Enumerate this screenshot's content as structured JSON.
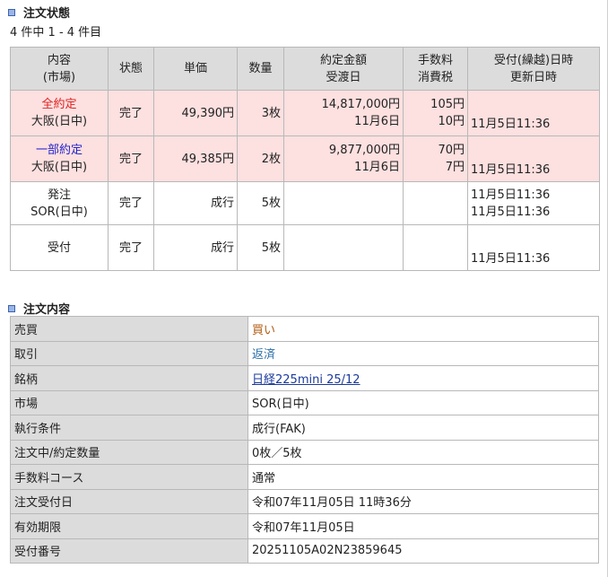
{
  "status_section": {
    "title": "注文状態",
    "count": "4 件中 1 - 4 件目",
    "headers": {
      "content": [
        "内容",
        "(市場)"
      ],
      "state": "状態",
      "unit_price": "単価",
      "quantity": "数量",
      "amount": [
        "約定金額",
        "受渡日"
      ],
      "fee": [
        "手数料",
        "消費税"
      ],
      "datetime": [
        "受付(繰越)日時",
        "更新日時"
      ]
    },
    "rows": [
      {
        "type": "全約定",
        "market": "大阪(日中)",
        "state": "完了",
        "price": "49,390円",
        "qty": "3枚",
        "amount": "14,817,000円",
        "delivery": "11月6日",
        "fee": "105円",
        "tax": "10円",
        "dt1": "",
        "dt2": "11月5日11:36"
      },
      {
        "type": "一部約定",
        "market": "大阪(日中)",
        "state": "完了",
        "price": "49,385円",
        "qty": "2枚",
        "amount": "9,877,000円",
        "delivery": "11月6日",
        "fee": "70円",
        "tax": "7円",
        "dt1": "",
        "dt2": "11月5日11:36"
      },
      {
        "type": "発注",
        "market": "SOR(日中)",
        "state": "完了",
        "price": "成行",
        "qty": "5枚",
        "dt1": "11月5日11:36",
        "dt2": "11月5日11:36"
      },
      {
        "type": "受付",
        "state": "完了",
        "price": "成行",
        "qty": "5枚",
        "dt2": "11月5日11:36"
      }
    ]
  },
  "detail_section": {
    "title": "注文内容",
    "rows": [
      {
        "label": "売買",
        "value": "買い"
      },
      {
        "label": "取引",
        "value": "返済"
      },
      {
        "label": "銘柄",
        "value": "日経225mini 25/12"
      },
      {
        "label": "市場",
        "value": "SOR(日中)"
      },
      {
        "label": "執行条件",
        "value": "成行(FAK)"
      },
      {
        "label": "注文中/約定数量",
        "value": "0枚／5枚"
      },
      {
        "label": "手数料コース",
        "value": "通常"
      },
      {
        "label": "注文受付日",
        "value": "令和07年11月05日 11時36分"
      },
      {
        "label": "有効期限",
        "value": "令和07年11月05日"
      },
      {
        "label": "受付番号",
        "value": "20251105A02N23859645"
      }
    ]
  },
  "colors": {
    "full_fill": "#e02020",
    "partial_fill": "#2222cc",
    "buy": "#b05a10",
    "settle": "#2a6fa8",
    "link": "#1a3a9c",
    "pink_row": "#fde0e0",
    "header_bg": "#dcdcdc"
  }
}
